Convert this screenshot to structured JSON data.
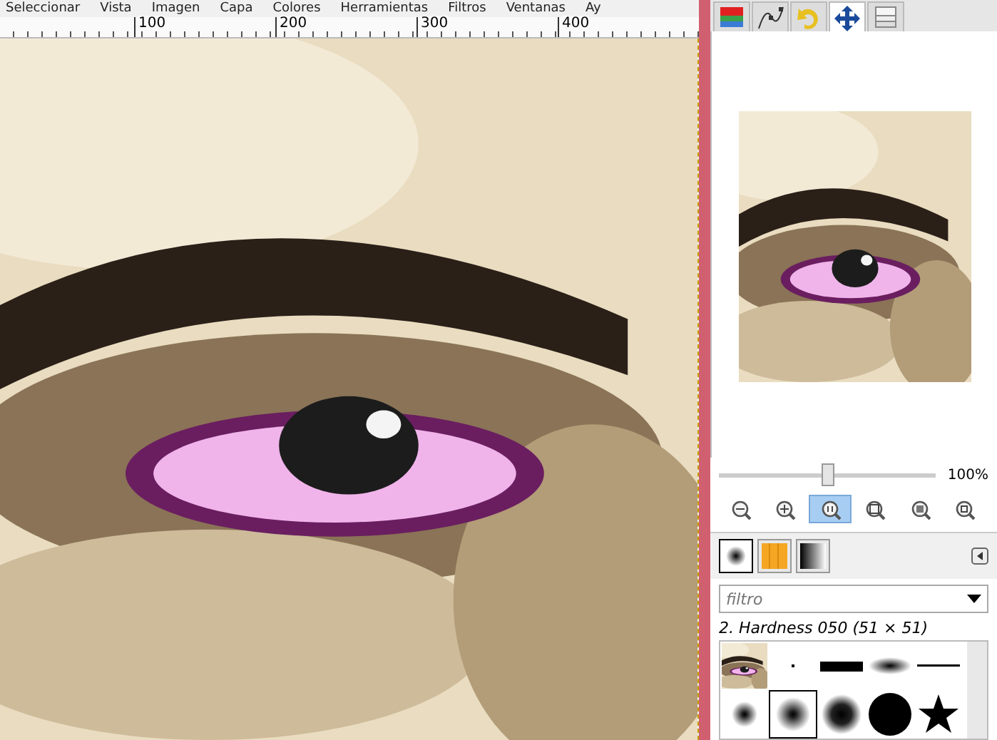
{
  "menu": [
    "Seleccionar",
    "Vista",
    "Imagen",
    "Capa",
    "Colores",
    "Herramientas",
    "Filtros",
    "Ventanas",
    "Ay"
  ],
  "ruler": {
    "labels": [
      "100",
      "200",
      "300",
      "400"
    ]
  },
  "canvas": {
    "kind": "picture"
  },
  "dock_tabs": [
    {
      "kind": "layers",
      "selected": false
    },
    {
      "kind": "paths",
      "selected": false
    },
    {
      "kind": "undo",
      "selected": false
    },
    {
      "kind": "move",
      "selected": true
    },
    {
      "kind": "document",
      "selected": false
    }
  ],
  "navigator": {
    "preview": {
      "kind": "picture"
    },
    "zoom": {
      "level": 0.5,
      "reading": "100%"
    },
    "buttons": [
      {
        "kind": "zoom-out",
        "selected": false
      },
      {
        "kind": "zoom-in",
        "selected": false
      },
      {
        "kind": "zoom-one",
        "selected": true
      },
      {
        "kind": "zoom-fit",
        "selected": false
      },
      {
        "kind": "zoom-fill",
        "selected": false
      },
      {
        "kind": "zoom-shrink",
        "selected": false
      }
    ]
  },
  "brush_tabs": [
    {
      "kind": "brush",
      "selected": true
    },
    {
      "kind": "pattern",
      "selected": false
    },
    {
      "kind": "gradient",
      "selected": false
    }
  ],
  "filter": {
    "placeholder": "filtro"
  },
  "brush_name": "2. Hardness 050 (51 × 51)",
  "brushes": [
    {
      "kind": "picture",
      "selected": false
    },
    {
      "kind": "dot",
      "selected": false
    },
    {
      "kind": "bar",
      "selected": false
    },
    {
      "kind": "ellipse",
      "selected": false
    },
    {
      "kind": "line",
      "selected": false
    },
    {
      "kind": "soft-small",
      "selected": false
    },
    {
      "kind": "soft-medium",
      "selected": true
    },
    {
      "kind": "soft-large",
      "selected": false
    },
    {
      "kind": "circle",
      "selected": false
    },
    {
      "kind": "star",
      "selected": false
    }
  ]
}
